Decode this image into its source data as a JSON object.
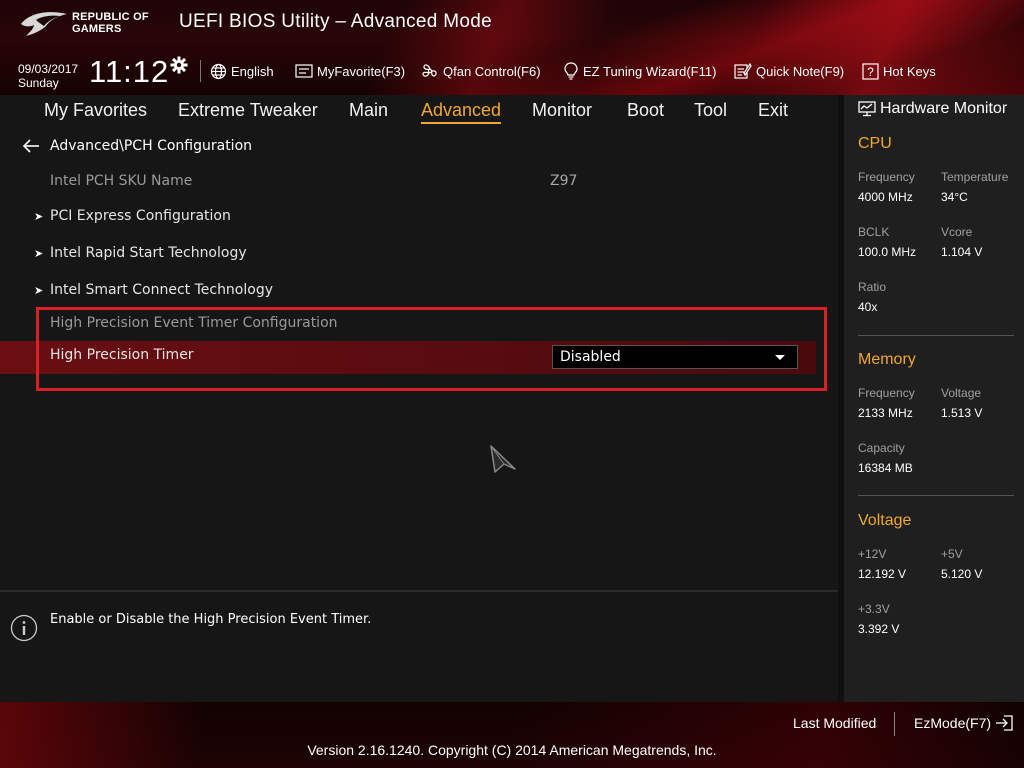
{
  "header": {
    "brand_line1": "REPUBLIC OF",
    "brand_line2": "GAMERS",
    "title": "UEFI BIOS Utility – Advanced Mode",
    "date": "09/03/2017",
    "day": "Sunday",
    "time": "11:12",
    "language": "English",
    "myfavorite": "MyFavorite(F3)",
    "qfan": "Qfan Control(F6)",
    "ez_tuning": "EZ Tuning Wizard(F11)",
    "quick_note": "Quick Note(F9)",
    "hot_keys": "Hot Keys"
  },
  "nav": {
    "tabs": [
      "My Favorites",
      "Extreme Tweaker",
      "Main",
      "Advanced",
      "Monitor",
      "Boot",
      "Tool",
      "Exit"
    ],
    "active": "Advanced"
  },
  "main": {
    "breadcrumb": "Advanced\\PCH Configuration",
    "sku_label": "Intel PCH SKU Name",
    "sku_value": "Z97",
    "submenus": [
      "PCI Express Configuration",
      "Intel Rapid Start Technology",
      "Intel Smart Connect Technology"
    ],
    "hpet_section": "High Precision Event Timer Configuration",
    "hpet_label": "High Precision Timer",
    "hpet_value": "Disabled"
  },
  "info": {
    "help_text": "Enable or Disable the High Precision Event Timer."
  },
  "hw_monitor": {
    "title": "Hardware Monitor",
    "cpu": {
      "heading": "CPU",
      "freq_label": "Frequency",
      "freq_value": "4000 MHz",
      "temp_label": "Temperature",
      "temp_value": "34°C",
      "bclk_label": "BCLK",
      "bclk_value": "100.0 MHz",
      "vcore_label": "Vcore",
      "vcore_value": "1.104 V",
      "ratio_label": "Ratio",
      "ratio_value": "40x"
    },
    "memory": {
      "heading": "Memory",
      "freq_label": "Frequency",
      "freq_value": "2133 MHz",
      "volt_label": "Voltage",
      "volt_value": "1.513 V",
      "cap_label": "Capacity",
      "cap_value": "16384 MB"
    },
    "voltage": {
      "heading": "Voltage",
      "v12_label": "+12V",
      "v12_value": "12.192 V",
      "v5_label": "+5V",
      "v5_value": "5.120 V",
      "v33_label": "+3.3V",
      "v33_value": "3.392 V"
    }
  },
  "footer": {
    "last_modified": "Last Modified",
    "ezmode": "EzMode(F7)",
    "version": "Version 2.16.1240. Copyright (C) 2014 American Megatrends, Inc."
  },
  "colors": {
    "accent": "#f0a830",
    "highlight_box": "#d8202a"
  }
}
